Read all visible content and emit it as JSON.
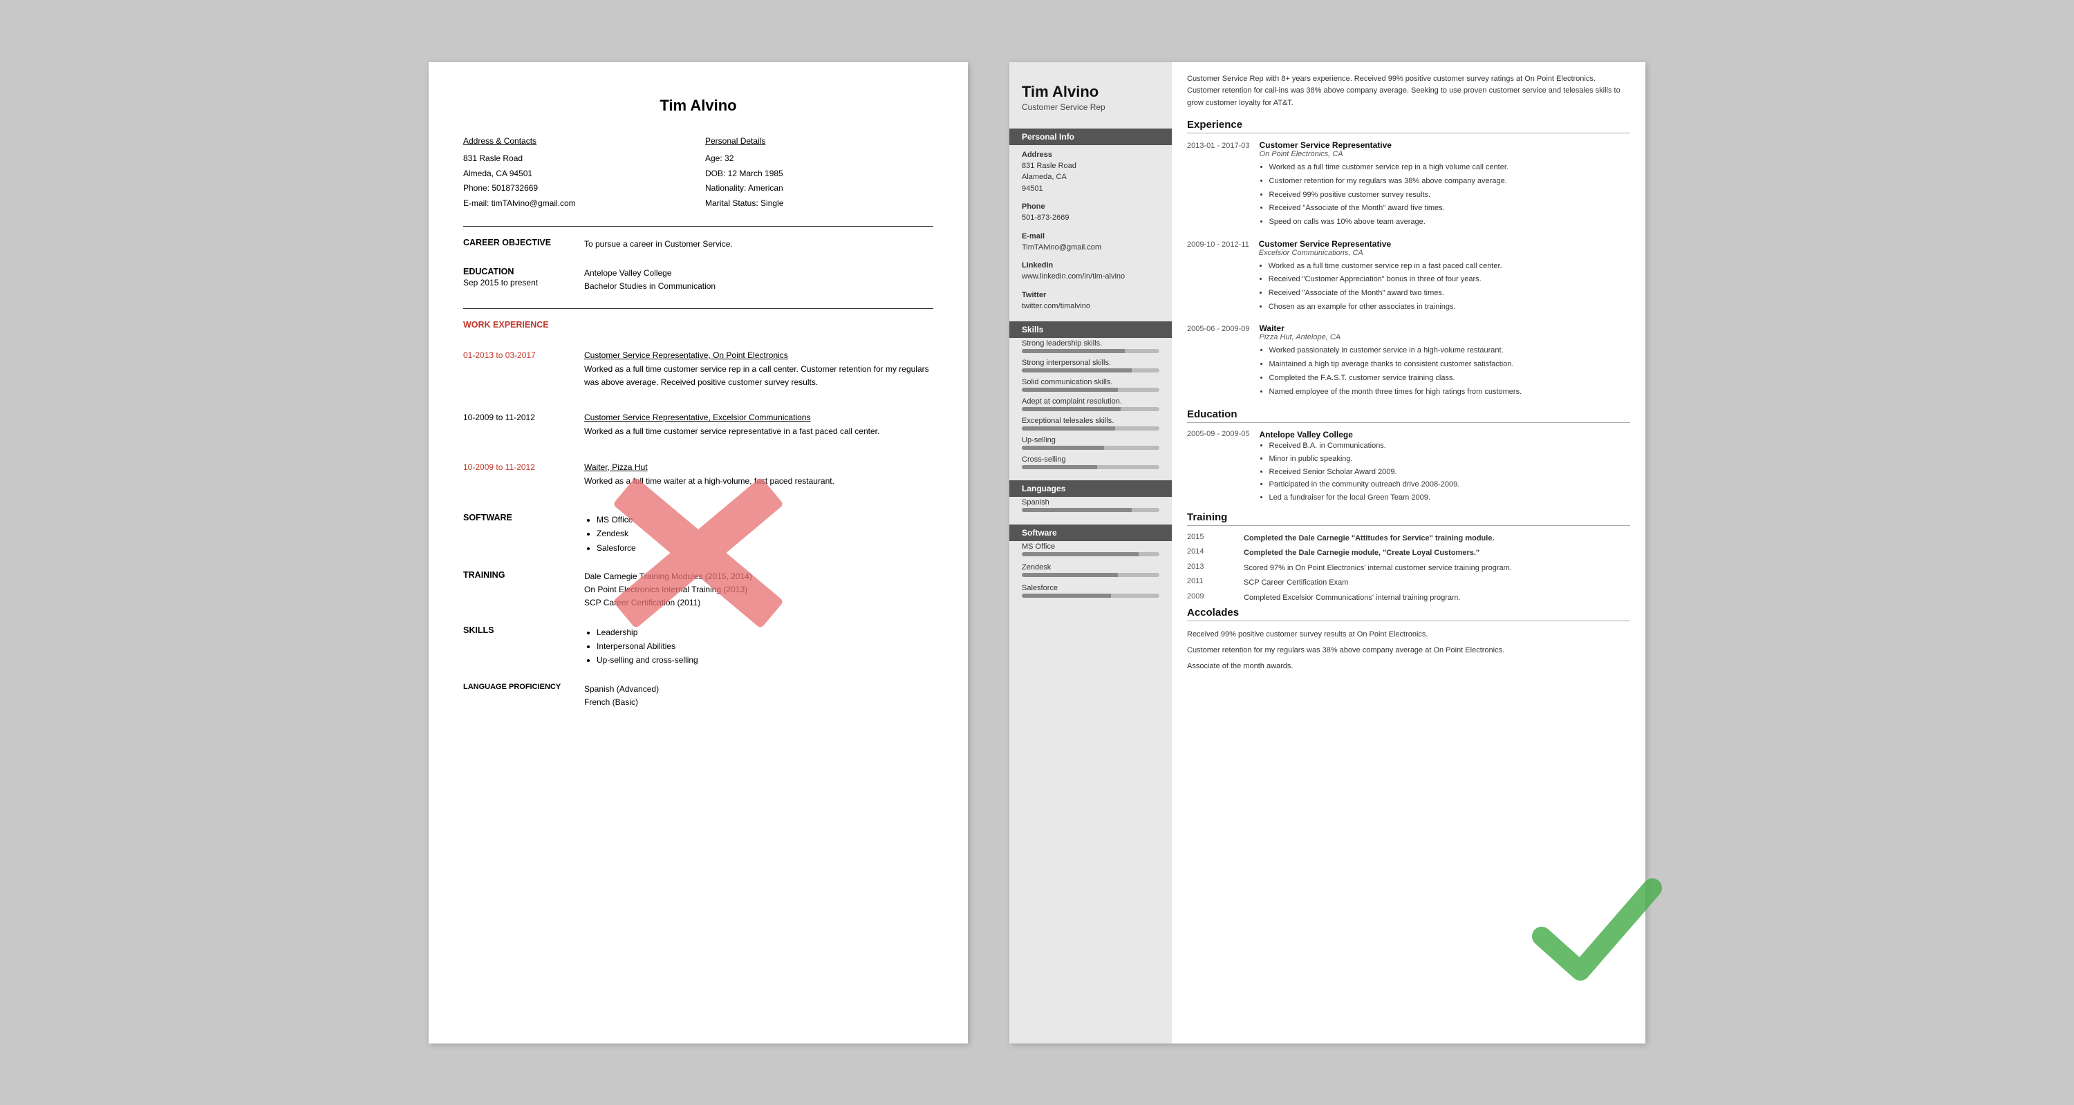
{
  "left_resume": {
    "name": "Tim Alvino",
    "contact_left": {
      "title": "Address & Contacts",
      "lines": [
        "831 Rasle Road",
        "Almeda, CA 94501",
        "Phone: 5018732669",
        "E-mail: timTAlvino@gmail.com"
      ]
    },
    "contact_right": {
      "title": "Personal Details",
      "lines": [
        "Age:   32",
        "DOB:  12 March 1985",
        "Nationality: American",
        "Marital Status: Single"
      ]
    },
    "career_objective_label": "CAREER OBJECTIVE",
    "career_objective_text": "To pursue a career in Customer Service.",
    "education_label": "EDUCATION",
    "education_dates": "Sep 2015 to present",
    "education_school": "Antelope Valley College",
    "education_degree": "Bachelor Studies in Communication",
    "work_experience_label": "WORK EXPERIENCE",
    "experiences": [
      {
        "dates": "01-2013 to 03-2017",
        "title": "Customer Service Representative, On Point Electronics",
        "text": "Worked as a full time customer service rep in a call center. Customer retention for my regulars was above average. Received positive customer survey results."
      },
      {
        "dates": "10-2009 to 11-2012",
        "title": "Customer Service Representative, Excelsior Communications",
        "text": "Worked as a full time customer service representative in a fast paced call center."
      },
      {
        "dates": "10-2009 to 11-2012",
        "title": "Waiter, Pizza Hut",
        "text": "Worked as a full time waiter at a high-volume, fast paced restaurant."
      }
    ],
    "software_label": "SOFTWARE",
    "software_items": [
      "MS Office",
      "Zendesk",
      "Salesforce"
    ],
    "training_label": "TRAINING",
    "training_items": [
      "Dale Carnegie Training Modules (2015, 2014)",
      "On Point Electronics Internal Training (2013)",
      "SCP Career Certification (2011)"
    ],
    "skills_label": "SKILLS",
    "skills_items": [
      "Leadership",
      "Interpersonal Abilities",
      "Up-selling and cross-selling"
    ],
    "language_label": "LANGUAGE PROFICIENCY",
    "language_items": [
      "Spanish (Advanced)",
      "French (Basic)"
    ]
  },
  "right_resume": {
    "name": "Tim Alvino",
    "subtitle": "Customer Service Rep",
    "summary": "Customer Service Rep with 8+ years experience. Received 99% positive customer survey ratings at On Point Electronics. Customer retention for call-ins was 38% above company average. Seeking to use proven customer service and telesales skills to grow customer loyalty for AT&T.",
    "sidebar": {
      "personal_info_label": "Personal Info",
      "address_label": "Address",
      "address_lines": [
        "831 Rasle Road",
        "Alameda, CA",
        "94501"
      ],
      "phone_label": "Phone",
      "phone_value": "501-873-2669",
      "email_label": "E-mail",
      "email_value": "TimTAlvino@gmail.com",
      "linkedin_label": "LinkedIn",
      "linkedin_value": "www.linkedin.com/in/tim-alvino",
      "twitter_label": "Twitter",
      "twitter_value": "twitter.com/timalvino",
      "skills_label": "Skills",
      "skills": [
        {
          "label": "Strong leadership skills.",
          "pct": 75
        },
        {
          "label": "Strong interpersonal skills.",
          "pct": 80
        },
        {
          "label": "Solid communication skills.",
          "pct": 70
        },
        {
          "label": "Adept at complaint resolution.",
          "pct": 72
        },
        {
          "label": "Exceptional telesales skills.",
          "pct": 68
        },
        {
          "label": "Up-selling",
          "pct": 60
        },
        {
          "label": "Cross-selling",
          "pct": 55
        }
      ],
      "languages_label": "Languages",
      "languages": [
        {
          "label": "Spanish",
          "pct": 80
        }
      ],
      "software_label": "Software",
      "software": [
        {
          "label": "MS Office",
          "pct": 85
        },
        {
          "label": "Zendesk",
          "pct": 70
        },
        {
          "label": "Salesforce",
          "pct": 65
        }
      ]
    },
    "experience_section": "Experience",
    "experiences": [
      {
        "dates": "2013-01 - 2017-03",
        "title": "Customer Service Representative",
        "company": "On Point Electronics, CA",
        "bullets": [
          "Worked as a full time customer service rep in a high volume call center.",
          "Customer retention for my regulars was 38% above company average.",
          "Received 99% positive customer survey results.",
          "Received \"Associate of the Month\" award five times.",
          "Speed on calls was 10% above team average."
        ]
      },
      {
        "dates": "2009-10 - 2012-11",
        "title": "Customer Service Representative",
        "company": "Excelsior Communications, CA",
        "bullets": [
          "Worked as a full time customer service rep in a fast paced call center.",
          "Received \"Customer Appreciation\" bonus in three of four years.",
          "Received \"Associate of the Month\" award two times.",
          "Chosen as an example for other associates in trainings."
        ]
      },
      {
        "dates": "2005-06 - 2009-09",
        "title": "Waiter",
        "company": "Pizza Hut, Antelope, CA",
        "bullets": [
          "Worked passionately in customer service in a high-volume restaurant.",
          "Maintained a high tip average thanks to consistent customer satisfaction.",
          "Completed the F.A.S.T. customer service training class.",
          "Named employee of the month three times for high ratings from customers."
        ]
      }
    ],
    "education_section": "Education",
    "education": [
      {
        "dates": "2005-09 - 2009-05",
        "school": "Antelope Valley College",
        "bullets": [
          "Received B.A. in Communications.",
          "Minor in public speaking.",
          "Received Senior Scholar Award 2009.",
          "Participated in the community outreach drive 2008-2009.",
          "Led a fundraiser for the local Green Team 2009."
        ]
      }
    ],
    "training_section": "Training",
    "training": [
      {
        "year": "2015",
        "text": "Completed the Dale Carnegie \"Attitudes for Service\" training module."
      },
      {
        "year": "2014",
        "text": "Completed the Dale Carnegie module, \"Create Loyal Customers.\""
      },
      {
        "year": "2013",
        "text": "Scored 97% in On Point Electronics' internal customer service training program."
      },
      {
        "year": "2011",
        "text": "SCP Career Certification Exam"
      },
      {
        "year": "2009",
        "text": "Completed Excelsior Communications' internal training program."
      }
    ],
    "accolades_section": "Accolades",
    "accolades": [
      "Received 99% positive customer survey results at On Point Electronics.",
      "Customer retention for my regulars was 38% above company average at On Point Electronics.",
      "Associate of the month awards."
    ]
  }
}
